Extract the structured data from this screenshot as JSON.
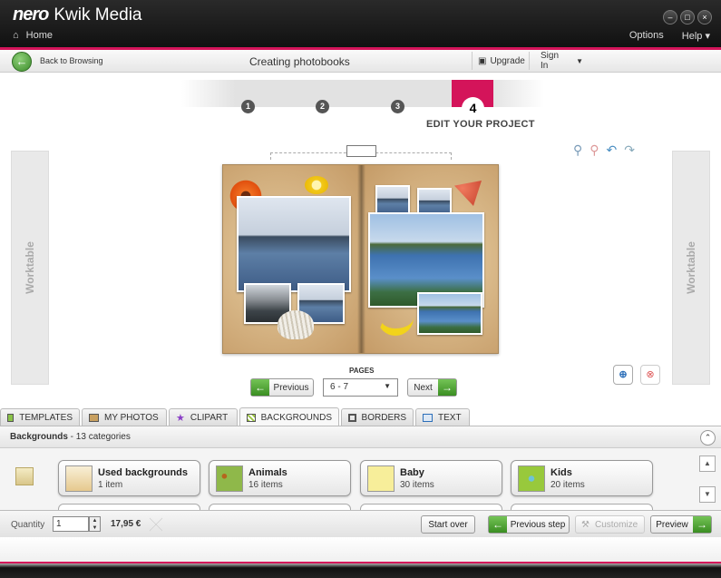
{
  "app": {
    "brand": "nero",
    "title": "Kwik Media"
  },
  "header": {
    "home_label": "Home",
    "options_label": "Options",
    "help_label": "Help"
  },
  "window": {
    "minimize": "–",
    "restore": "□",
    "close": "×"
  },
  "navbar": {
    "back_label": "Back to Browsing",
    "title": "Creating photobooks",
    "upgrade_label": "Upgrade",
    "signin_label": "Sign In"
  },
  "steps": {
    "items": [
      "1",
      "2",
      "3",
      "4"
    ],
    "active_label": "EDIT YOUR PROJECT"
  },
  "worktable": {
    "left_label": "Worktable",
    "right_label": "Worktable"
  },
  "toolbar_icons": [
    "zoom-in-icon",
    "zoom-out-icon",
    "undo-icon",
    "redo-icon"
  ],
  "pages": {
    "label": "PAGES",
    "previous_label": "Previous",
    "next_label": "Next",
    "selected": "6 - 7"
  },
  "tabs": [
    {
      "label": "TEMPLATES",
      "icon": "templates-icon"
    },
    {
      "label": "MY PHOTOS",
      "icon": "my-photos-icon"
    },
    {
      "label": "CLIPART",
      "icon": "clipart-icon"
    },
    {
      "label": "BACKGROUNDS",
      "icon": "backgrounds-icon"
    },
    {
      "label": "BORDERS",
      "icon": "borders-icon"
    },
    {
      "label": "TEXT",
      "icon": "text-icon"
    }
  ],
  "categories": {
    "title": "Backgrounds",
    "subtitle": " - 13 categories",
    "items": [
      {
        "name": "Used backgrounds",
        "count": "1 item"
      },
      {
        "name": "Animals",
        "count": "16 items"
      },
      {
        "name": "Baby",
        "count": "30 items"
      },
      {
        "name": "Kids",
        "count": "20 items"
      }
    ]
  },
  "bottombar": {
    "quantity_label": "Quantity",
    "quantity_value": "1",
    "price": "17,95 €",
    "start_over_label": "Start over",
    "previous_step_label": "Previous step",
    "customize_label": "Customize",
    "preview_label": "Preview"
  },
  "colors": {
    "accent": "#d4145a",
    "green": "#3a8d22"
  }
}
